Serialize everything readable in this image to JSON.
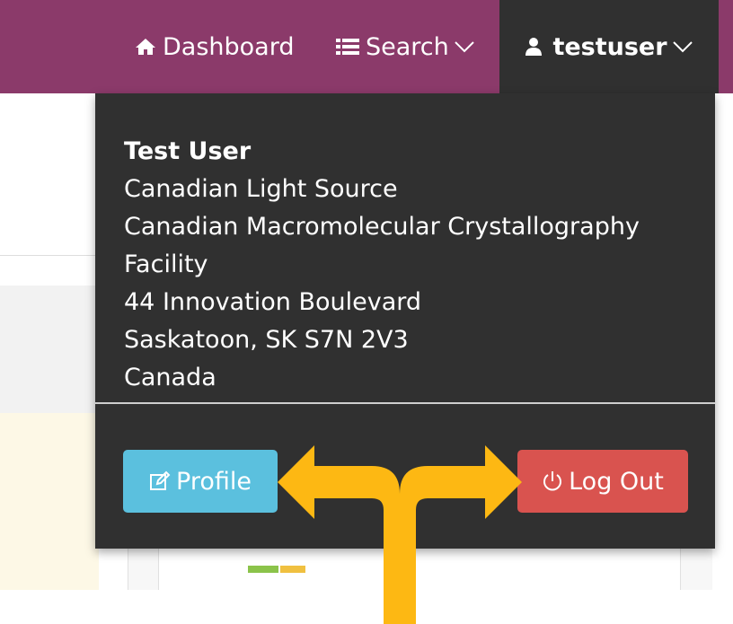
{
  "navbar": {
    "dashboard_label": "Dashboard",
    "search_label": "Search",
    "user_label": "testuser",
    "bg_color": "#8b3a6a",
    "active_bg_color": "#303030"
  },
  "dropdown": {
    "name": "Test User",
    "address_lines": [
      "Canadian Light Source",
      "Canadian Macromolecular Crystallography Facility",
      "44 Innovation Boulevard",
      "Saskatoon, SK  S7N 2V3",
      "Canada"
    ],
    "profile_label": "Profile",
    "logout_label": "Log Out",
    "profile_color": "#5bc0de",
    "logout_color": "#d9534f"
  },
  "annotation": {
    "arrow_color": "#fdb813",
    "arrow_shape": "branching-arrow-pointing-to-both-buttons"
  }
}
